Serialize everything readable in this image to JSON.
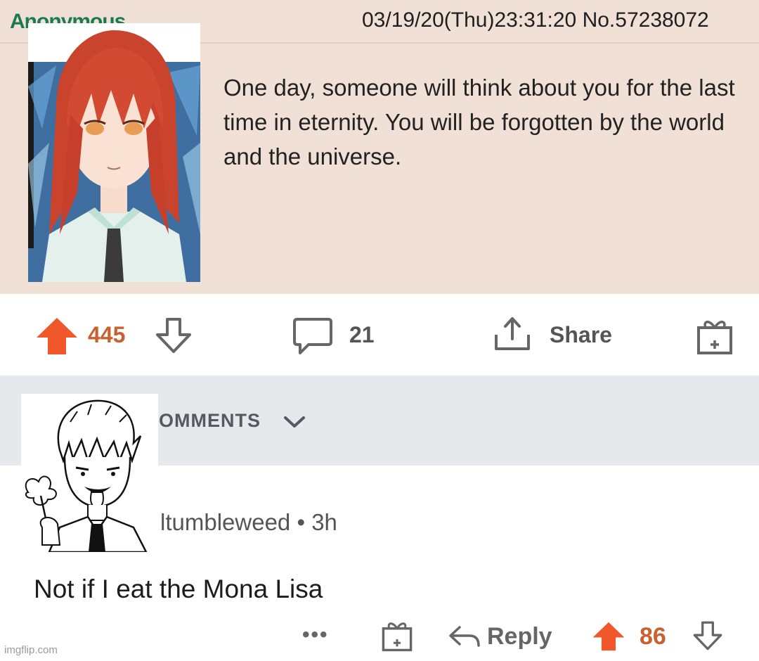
{
  "post": {
    "poster_name": "Anonymous",
    "date": "03/19/20(Thu)23:31:20",
    "post_number": "No.57238072",
    "body": "One day, someone will think about you for the last time in eternity. You will be forgotten by the world and the universe."
  },
  "actions": {
    "upvotes": "445",
    "comments": "21",
    "share_label": "Share"
  },
  "comments_section": {
    "sort_label": "OMMENTS"
  },
  "comment": {
    "author": "ltumbleweed",
    "age": "3h",
    "separator": "•",
    "body": "Not if I eat the Mona Lisa",
    "more_label": "•••",
    "reply_label": "Reply",
    "votes": "86"
  },
  "watermark": "imgflip.com",
  "colors": {
    "post_bg": "#f0e0d6",
    "upvote": "#f0582b",
    "comments_bar": "#e6e9ec"
  },
  "icons": [
    "upvote-arrow-icon",
    "downvote-arrow-icon",
    "comment-bubble-icon",
    "share-icon",
    "award-gift-icon",
    "chevron-down-icon",
    "reply-arrow-icon"
  ]
}
